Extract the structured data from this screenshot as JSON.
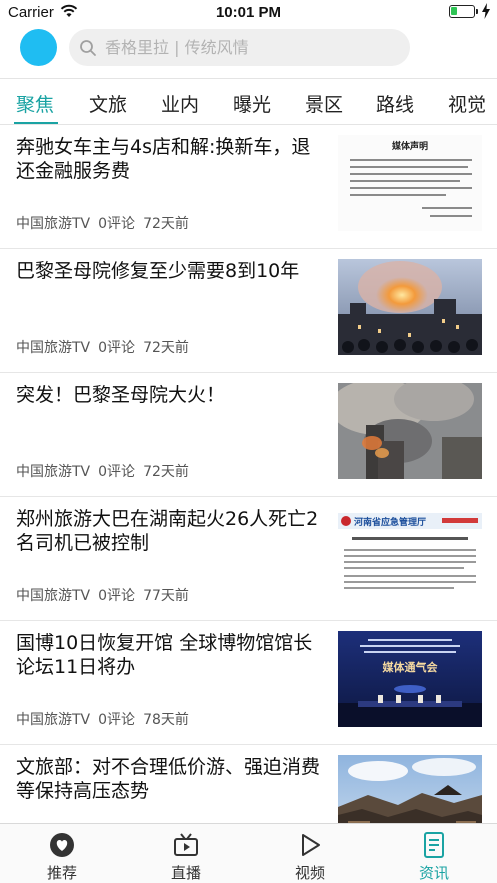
{
  "status_bar": {
    "carrier": "Carrier",
    "time": "10:01 PM",
    "battery_level": 0.3
  },
  "header": {
    "search_placeholder": "香格里拉 | 传统风情",
    "avatar_color": "#1fbdf2"
  },
  "tabs": [
    "聚焦",
    "文旅",
    "业内",
    "曝光",
    "景区",
    "路线",
    "视觉"
  ],
  "active_tab": "聚焦",
  "accent_color": "#1aa3a3",
  "news": [
    {
      "title": "奔驰女车主与4s店和解:换新车，退还金融服务费",
      "source": "中国旅游TV",
      "comments": "0评论",
      "time": "72天前",
      "thumb": "document-statement"
    },
    {
      "title": "巴黎圣母院修复至少需要8到10年",
      "source": "中国旅游TV",
      "comments": "0评论",
      "time": "72天前",
      "thumb": "cathedral-fire-night"
    },
    {
      "title": "突发！巴黎圣母院大火！",
      "source": "中国旅游TV",
      "comments": "0评论",
      "time": "72天前",
      "thumb": "cathedral-smoke"
    },
    {
      "title": "郑州旅游大巴在湖南起火26人死亡2名司机已被控制",
      "source": "中国旅游TV",
      "comments": "0评论",
      "time": "77天前",
      "thumb": "government-webpage"
    },
    {
      "title": "国博10日恢复开馆 全球博物馆馆长论坛11日将办",
      "source": "中国旅游TV",
      "comments": "0评论",
      "time": "78天前",
      "thumb": "press-conference"
    },
    {
      "title": "文旅部：对不合理低价游、强迫消费等保持高压态势",
      "source": "",
      "comments": "",
      "time": "",
      "thumb": "old-town"
    }
  ],
  "thumb_text": {
    "statement_title": "媒体声明",
    "gov_header": "河南省应急管理厅",
    "press_banner": "媒体通气会"
  },
  "tabbar": [
    {
      "label": "推荐",
      "icon": "heart-icon"
    },
    {
      "label": "直播",
      "icon": "tv-icon"
    },
    {
      "label": "视频",
      "icon": "play-icon"
    },
    {
      "label": "资讯",
      "icon": "document-icon"
    }
  ],
  "active_tabbar": "资讯"
}
